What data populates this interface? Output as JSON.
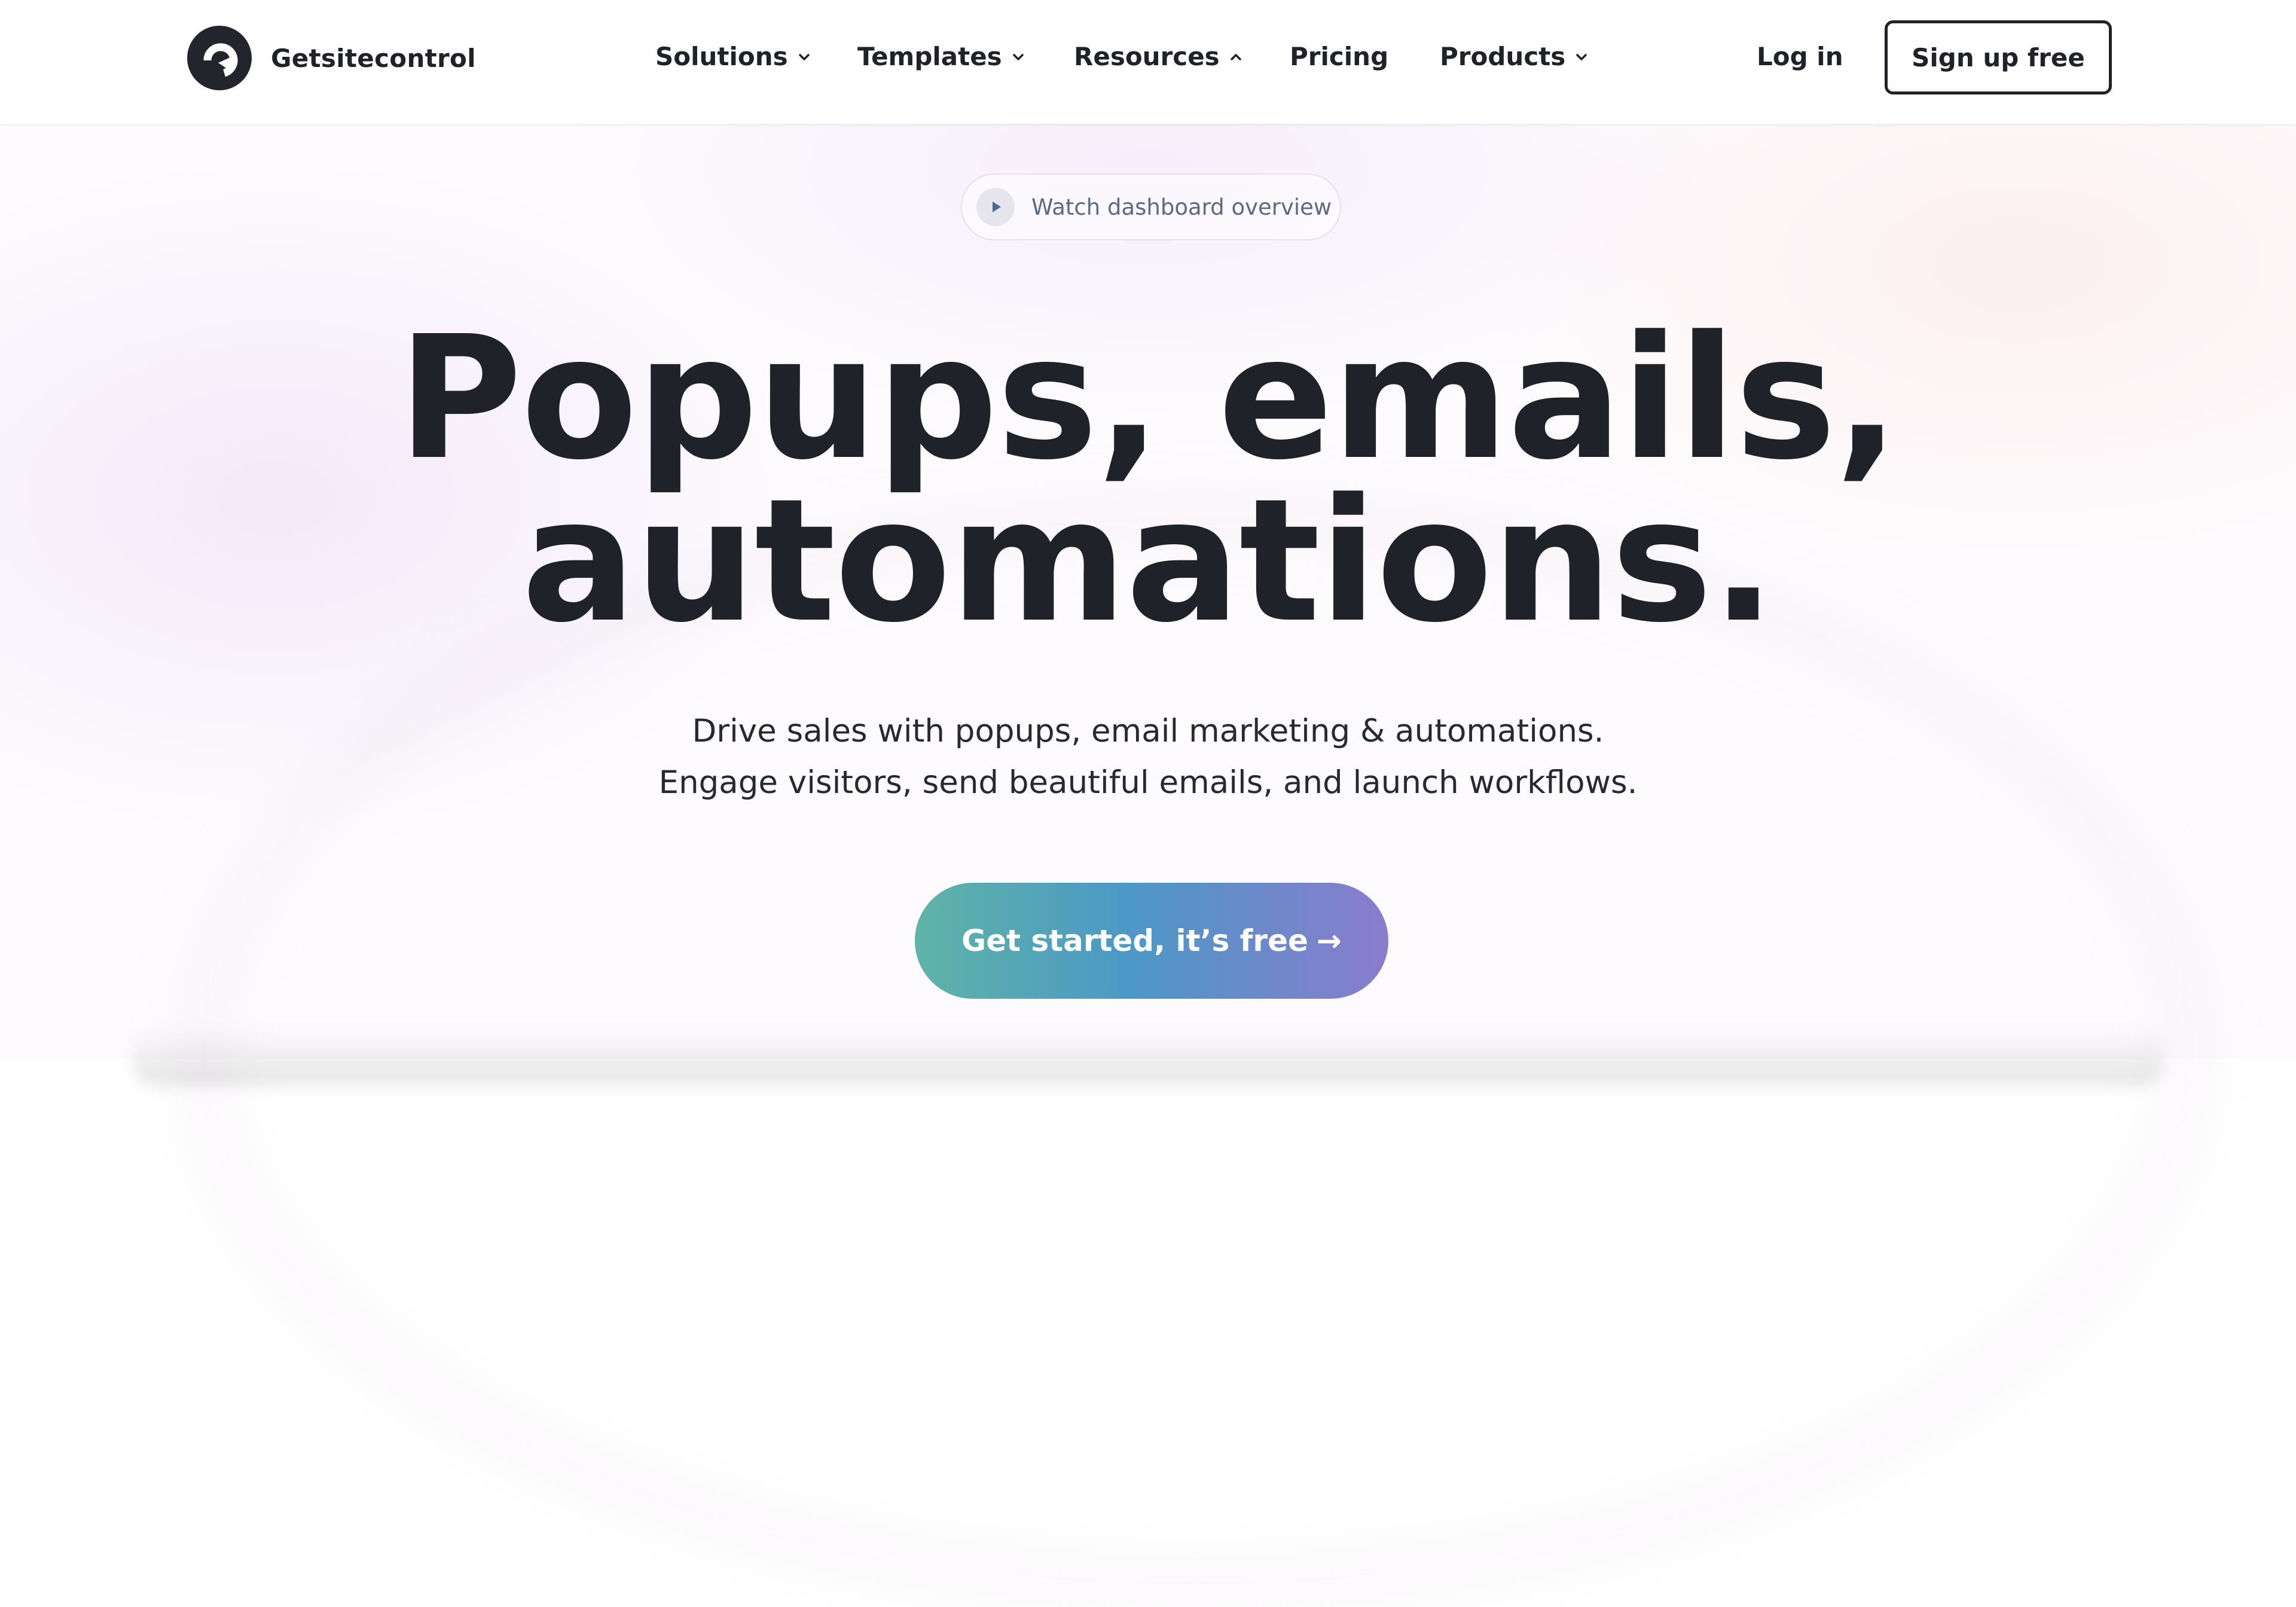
{
  "brand": {
    "name": "Getsitecontrol",
    "logo_icon": "getsitecontrol-logo-icon"
  },
  "nav": {
    "items": [
      {
        "label": "Solutions",
        "has_dropdown": true,
        "expanded": false
      },
      {
        "label": "Templates",
        "has_dropdown": true,
        "expanded": false
      },
      {
        "label": "Resources",
        "has_dropdown": true,
        "expanded": true
      },
      {
        "label": "Pricing",
        "has_dropdown": false
      },
      {
        "label": "Products",
        "has_dropdown": true,
        "expanded": false
      }
    ],
    "login_label": "Log in",
    "signup_label": "Sign up free"
  },
  "hero": {
    "video_pill_label": "Watch dashboard overview",
    "video_pill_icon": "play-icon",
    "headline_line1": "Popups, emails,",
    "headline_line2": "automations.",
    "sub_line1": "Drive sales with popups, email marketing & automations.",
    "sub_line2": "Engage visitors, send beautiful emails, and launch workflows.",
    "cta_label": "Get started, it’s free",
    "cta_arrow": "→"
  },
  "colors": {
    "text_dark": "#1f2228",
    "muted_text": "#5c6a80",
    "cta_gradient": [
      "#5fb4a7",
      "#4c98c6",
      "#8a7ccd"
    ]
  }
}
